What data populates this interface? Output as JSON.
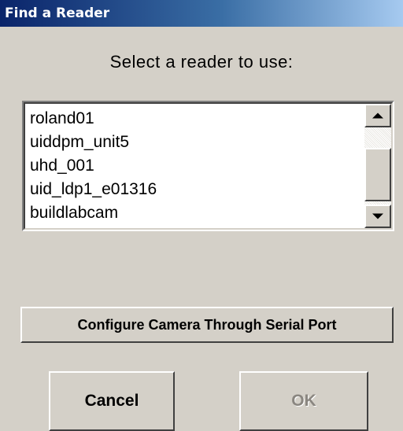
{
  "window": {
    "title": "Find a Reader"
  },
  "prompt": "Select a reader to use:",
  "reader_list": {
    "items": [
      "roland01",
      "uiddpm_unit5",
      "uhd_001",
      "uid_ldp1_e01316",
      "buildlabcam"
    ]
  },
  "buttons": {
    "configure_label": "Configure Camera Through Serial Port",
    "cancel_label": "Cancel",
    "ok_label": "OK"
  },
  "icons": {
    "scroll_up": "scroll-up-arrow-icon",
    "scroll_down": "scroll-down-arrow-icon"
  },
  "colors": {
    "title_bar_start": "#0a246a",
    "title_bar_end": "#a6caf0",
    "dialog_background": "#d4d0c8",
    "disabled_text": "#8a8680"
  }
}
